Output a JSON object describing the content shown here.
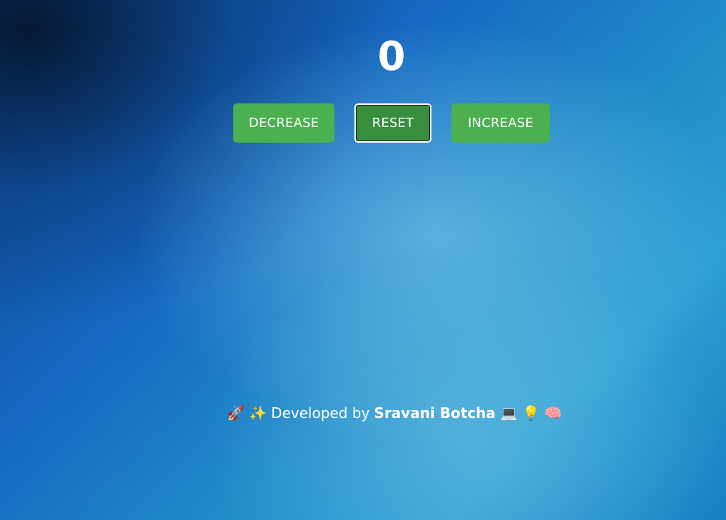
{
  "counter": {
    "value": "0"
  },
  "buttons": {
    "decrease_label": "DECREASE",
    "reset_label": "RESET",
    "increase_label": "INCREASE"
  },
  "footer": {
    "emoji_rocket": "🚀",
    "emoji_sparkles": "✨",
    "prefix": "Developed by",
    "author": "Sravani Botcha",
    "emoji_laptop": "💻",
    "emoji_bulb": "💡",
    "emoji_brain": "🧠"
  },
  "colors": {
    "button_bg": "#4caf50",
    "button_active_bg": "#388e3c",
    "text": "#ffffff"
  }
}
